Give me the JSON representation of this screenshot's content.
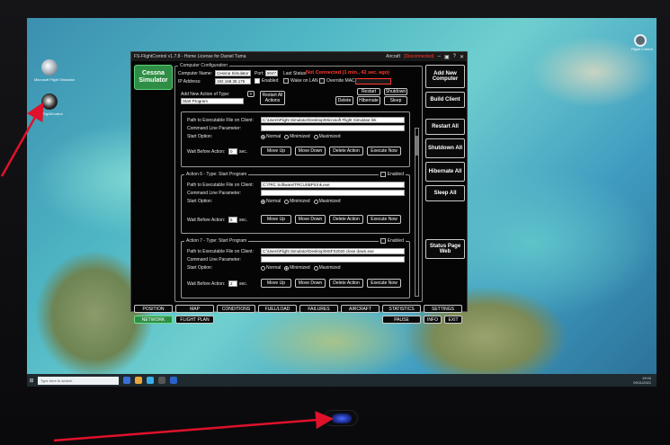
{
  "window": {
    "title": "FS-FlightControl v1.7.8 - Home License for Daniel Tuma",
    "aircraft_label": "Aircraft",
    "aircraft_status": "(Disconnected)"
  },
  "sim_button": {
    "line1": "Cessna",
    "line2": "Simulator"
  },
  "computer_config": {
    "legend": "Computer Configuration",
    "name_label": "Computer Name:",
    "name_value": "Cessna Simulator",
    "ip_label": "IP Address:",
    "ip_value": "192.168.35.175",
    "port_label": "Port:",
    "port_value": "8047",
    "enabled_label": "Enabled",
    "wake_on_lan_label": "Wake on LAN",
    "override_mac_label": "Override MAC",
    "last_status_label": "Last Status:",
    "last_status_value": "Not Connected (1 min., 42 sec. ago)",
    "add_action_label": "Add New Action of Type:",
    "action_type_value": "Start Program",
    "restart_all_actions": "Restart All Actions",
    "delete": "Delete",
    "restart": "Restart",
    "hibernate": "Hibernate",
    "shutdown": "Shutdown",
    "sleep": "Sleep"
  },
  "actions": [
    {
      "title": "",
      "path_label": "Path to Executable File on Client:",
      "path_value": "C:\\Users\\Flight Simulator\\Desktop\\Microsoft Flight Simulator.lnk",
      "param_label": "Command Line Parameter:",
      "start_label": "Start Option:",
      "normal": "Normal",
      "minimized": "Minimized",
      "maximized": "Maximized",
      "wait_label": "Wait Before Action:",
      "wait_value": "0",
      "sec": "sec.",
      "move_up": "Move Up",
      "move_down": "Move Down",
      "delete_action": "Delete Action",
      "execute_now": "Execute Now"
    },
    {
      "title": "Action 6 - Type: Start Program",
      "enabled_label": "Enabled",
      "path_label": "Path to Executable File on Client:",
      "path_value": "C:\\TRC Software\\TRCUSBPit.lnk.exe",
      "param_label": "Command Line Parameter:",
      "start_label": "Start Option:",
      "normal": "Normal",
      "minimized": "Minimized",
      "maximized": "Maximized",
      "wait_label": "Wait Before Action:",
      "wait_value": "5",
      "sec": "sec.",
      "move_up": "Move Up",
      "move_down": "Move Down",
      "delete_action": "Delete Action",
      "execute_now": "Execute Now"
    },
    {
      "title": "Action 7 - Type: Start Program",
      "enabled_label": "Enabled",
      "path_label": "Path to Executable File on Client:",
      "path_value": "C:\\Users\\Flight Simulator\\Desktop\\MSFS2020 close down.exe",
      "param_label": "Command Line Parameter:",
      "start_label": "Start Option:",
      "normal": "Normal",
      "minimized": "Minimized",
      "maximized": "Maximized",
      "wait_label": "Wait Before Action:",
      "wait_value": "2",
      "sec": "sec.",
      "move_up": "Move Up",
      "move_down": "Move Down",
      "delete_action": "Delete Action",
      "execute_now": "Execute Now"
    }
  ],
  "right_buttons": {
    "add_new_computer": "Add New Computer",
    "build_client": "Build Client",
    "restart_all": "Restart All",
    "shutdown_all": "Shutdown All",
    "hibernate_all": "Hibernate All",
    "sleep_all": "Sleep All",
    "status_page_web": "Status Page Web"
  },
  "tabs": {
    "position": "POSITION",
    "map": "MAP",
    "conditions": "CONDITIONS",
    "fuel_load": "FUEL/LOAD",
    "failures": "FAILURES",
    "aircraft": "AIRCRAFT",
    "statistics": "STATISTICS",
    "settings": "SETTINGS",
    "network": "NETWORK",
    "flight_plan": "FLIGHT PLAN",
    "pause": "PAUSE",
    "info": "INFO",
    "exit": "EXIT"
  },
  "taskbar": {
    "search_placeholder": "Type here to search",
    "time": "19:04",
    "date": "09/11/2021"
  },
  "desktop": {
    "icon1_label": "Microsoft Flight Simulator",
    "icon2_label": "FS-FlightControl",
    "corner_icon_label": "Flight Control"
  }
}
